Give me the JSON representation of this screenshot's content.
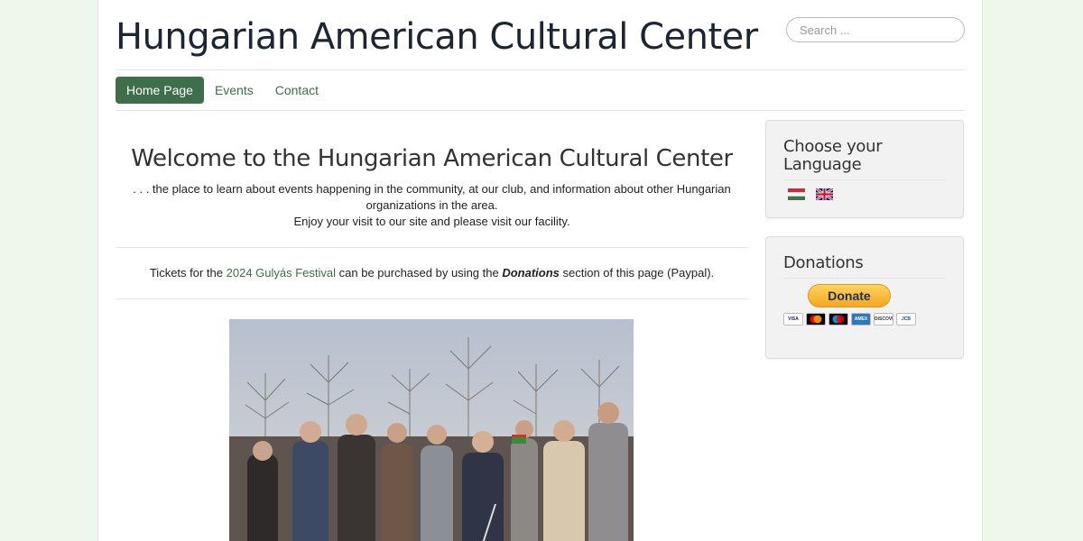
{
  "site": {
    "title": "Hungarian American Cultural Center"
  },
  "search": {
    "placeholder": "Search ..."
  },
  "nav": {
    "items": [
      {
        "label": "Home Page",
        "active": true
      },
      {
        "label": "Events",
        "active": false
      },
      {
        "label": "Contact",
        "active": false
      }
    ]
  },
  "main": {
    "heading": "Welcome to the Hungarian American Cultural Center",
    "intro_line1": ". . . the place to learn about events happening in the community, at our club, and information about other Hungarian organizations in the area.",
    "intro_line2": "Enjoy your visit to our site and please visit our facility.",
    "tickets": {
      "before": "Tickets for the ",
      "link": "2024 Gulyás Festival",
      "middle": " can be purchased by using the ",
      "emphasis": "Donations",
      "after": " section of this page (Paypal)."
    }
  },
  "sidebar": {
    "language": {
      "title": "Choose your Language",
      "flags": [
        "hungarian-flag",
        "uk-flag"
      ]
    },
    "donations": {
      "title": "Donations",
      "button_label": "Donate",
      "cards": [
        "VISA",
        "mastercard",
        "maestro",
        "AMEX",
        "DISCOVER",
        "JCB"
      ]
    }
  },
  "colors": {
    "accent": "#3f6e4c",
    "link": "#3b6e4a",
    "page_bg": "#eef7ea",
    "donate_yellow": "#ffc439"
  }
}
